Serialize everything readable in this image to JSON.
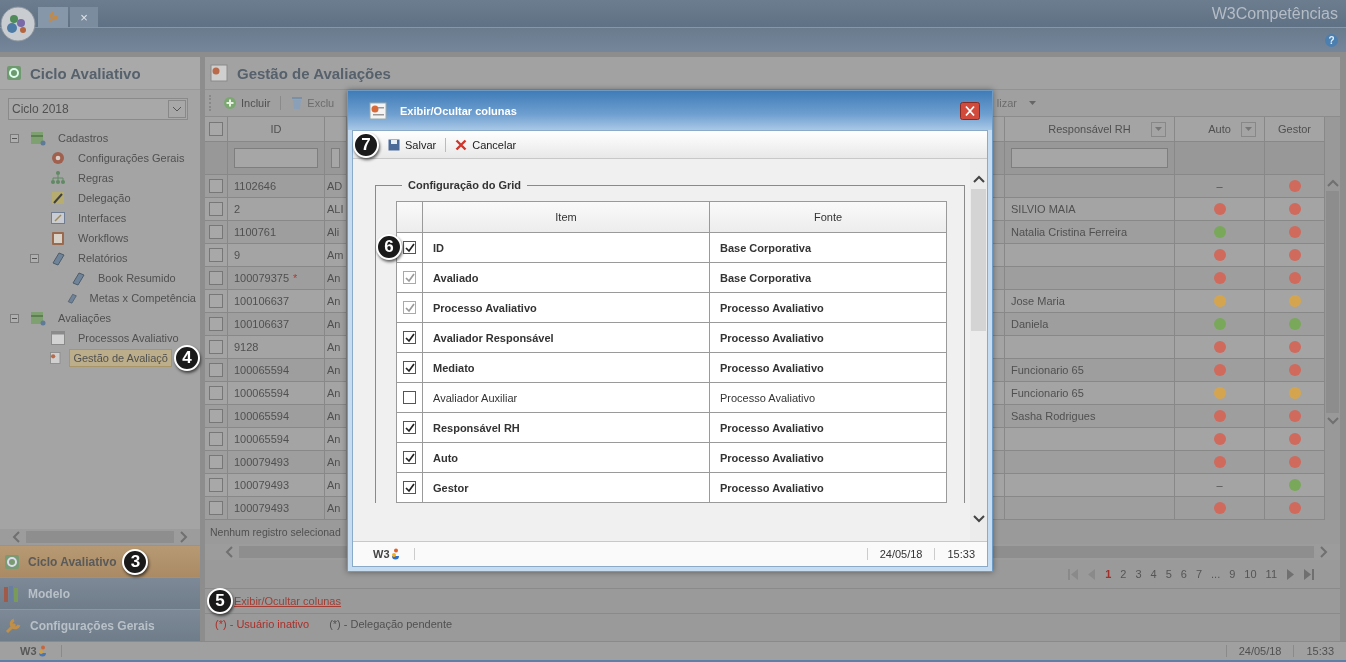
{
  "topbar": {
    "brand": "W3Competências",
    "close_tab": "×",
    "help": "?"
  },
  "sidebar": {
    "title": "Ciclo Avaliativo",
    "cycle_select": {
      "value": "Ciclo 2018"
    },
    "tree": [
      {
        "label": "Cadastros",
        "kind": "folder",
        "expanded": true,
        "selected": false,
        "children": [
          {
            "label": "Configurações Gerais",
            "kind": "gear",
            "selected": false
          },
          {
            "label": "Regras",
            "kind": "org",
            "selected": false
          },
          {
            "label": "Delegação",
            "kind": "pencil",
            "selected": false
          },
          {
            "label": "Interfaces",
            "kind": "form",
            "selected": false
          },
          {
            "label": "Workflows",
            "kind": "clipboard",
            "selected": false
          },
          {
            "label": "Relatórios",
            "kind": "book",
            "expanded": true,
            "selected": false,
            "children": [
              {
                "label": "Book Resumido",
                "kind": "book",
                "selected": false
              },
              {
                "label": "Metas x Competência",
                "kind": "book",
                "selected": false
              }
            ]
          }
        ]
      },
      {
        "label": "Avaliações",
        "kind": "folder",
        "expanded": true,
        "selected": false,
        "children": [
          {
            "label": "Processos Avaliativo",
            "kind": "calendar",
            "selected": false
          },
          {
            "label": "Gestão de Avaliaçõ",
            "kind": "report",
            "selected": true,
            "callout": "4"
          }
        ]
      }
    ],
    "accordion": [
      {
        "label": "Ciclo Avaliativo",
        "kind": "cycle",
        "selected": true,
        "callout": "3"
      },
      {
        "label": "Modelo",
        "kind": "model",
        "selected": false
      },
      {
        "label": "Configurações Gerais",
        "kind": "wrench",
        "selected": false
      }
    ]
  },
  "main": {
    "title": "Gestão de Avaliações",
    "toolbar": [
      {
        "label": "Incluir",
        "kind": "add",
        "disabled": false
      },
      {
        "label": "Exclu",
        "kind": "delete",
        "disabled": true
      }
    ],
    "toolbar_right": "lizar",
    "grid": {
      "header_checked": false,
      "columns": {
        "id": "ID",
        "rh": "Responsável RH",
        "auto": "Auto",
        "gestor": "Gestor"
      },
      "rows": [
        {
          "checked": false,
          "id": "1102646",
          "col3": "AD",
          "auto": {
            "kind": "dash",
            "text": "–"
          },
          "gestor": {
            "kind": "dot",
            "color": "#cf6a5d"
          }
        },
        {
          "checked": false,
          "id": "2",
          "col3": "ALI",
          "rh": "SILVIO MAIA",
          "auto": {
            "kind": "dot",
            "color": "#cf6a5d"
          },
          "gestor": {
            "kind": "dot",
            "color": "#cf6a5d"
          }
        },
        {
          "checked": false,
          "id": "1100761",
          "col3": "Ali",
          "rh": "Natalia Cristina Ferreira",
          "auto": {
            "kind": "dot",
            "color": "#7aa85a"
          },
          "gestor": {
            "kind": "dot",
            "color": "#cf6a5d"
          }
        },
        {
          "checked": false,
          "id": "9",
          "col3": "Am",
          "auto": {
            "kind": "dot",
            "color": "#cf6a5d"
          },
          "gestor": {
            "kind": "dot",
            "color": "#cf6a5d"
          }
        },
        {
          "checked": false,
          "id": "100079375",
          "flag": "*",
          "col3": "An",
          "auto": {
            "kind": "dot",
            "color": "#cf6a5d"
          },
          "gestor": {
            "kind": "dot",
            "color": "#cf6a5d"
          }
        },
        {
          "checked": false,
          "id": "100106637",
          "col3": "An",
          "rh": "Jose Maria",
          "auto": {
            "kind": "dot",
            "color": "#d4a54e"
          },
          "gestor": {
            "kind": "dot",
            "color": "#d4a54e"
          }
        },
        {
          "checked": false,
          "id": "100106637",
          "col3": "An",
          "rh": "Daniela",
          "auto": {
            "kind": "dot",
            "color": "#7aa85a"
          },
          "gestor": {
            "kind": "dot",
            "color": "#7aa85a"
          }
        },
        {
          "checked": false,
          "id": "9128",
          "col3": "An",
          "auto": {
            "kind": "dot",
            "color": "#cf6a5d"
          },
          "gestor": {
            "kind": "dot",
            "color": "#cf6a5d"
          }
        },
        {
          "checked": false,
          "id": "100065594",
          "col3": "An",
          "rh": "Funcionario 65",
          "auto": {
            "kind": "dot",
            "color": "#cf6a5d"
          },
          "gestor": {
            "kind": "dot",
            "color": "#cf6a5d"
          }
        },
        {
          "checked": false,
          "id": "100065594",
          "col3": "An",
          "rh": "Funcionario 65",
          "auto": {
            "kind": "dot",
            "color": "#d4a54e"
          },
          "gestor": {
            "kind": "dot",
            "color": "#d4a54e"
          }
        },
        {
          "checked": false,
          "id": "100065594",
          "col3": "An",
          "rh": "Sasha Rodrigues",
          "auto": {
            "kind": "dot",
            "color": "#cf6a5d"
          },
          "gestor": {
            "kind": "dot",
            "color": "#cf6a5d"
          }
        },
        {
          "checked": false,
          "id": "100065594",
          "col3": "An",
          "auto": {
            "kind": "dot",
            "color": "#cf6a5d"
          },
          "gestor": {
            "kind": "dot",
            "color": "#cf6a5d"
          }
        },
        {
          "checked": false,
          "id": "100079493",
          "col3": "An",
          "auto": {
            "kind": "dot",
            "color": "#cf6a5d"
          },
          "gestor": {
            "kind": "dot",
            "color": "#cf6a5d"
          }
        },
        {
          "checked": false,
          "id": "100079493",
          "col3": "An",
          "auto": {
            "kind": "dash",
            "text": "–"
          },
          "gestor": {
            "kind": "dot",
            "color": "#7aa85a"
          }
        },
        {
          "checked": false,
          "id": "100079493",
          "col3": "An",
          "auto": {
            "kind": "dot",
            "color": "#cf6a5d"
          },
          "gestor": {
            "kind": "dot",
            "color": "#cf6a5d"
          }
        }
      ]
    },
    "selection_info": "Nenhum registro selecionad",
    "pager": [
      {
        "label": "1",
        "selected": true
      },
      {
        "label": "2",
        "selected": false
      },
      {
        "label": "3",
        "selected": false
      },
      {
        "label": "4",
        "selected": false
      },
      {
        "label": "5",
        "selected": false
      },
      {
        "label": "6",
        "selected": false
      },
      {
        "label": "7",
        "selected": false
      },
      {
        "label": "...",
        "selected": false
      },
      {
        "label": "9",
        "selected": false
      },
      {
        "label": "10",
        "selected": false
      },
      {
        "label": "11",
        "selected": false
      }
    ],
    "columns_link": {
      "label": "Exibir/Ocultar colunas",
      "callout": "5"
    },
    "legend": [
      {
        "kind": "inactive",
        "text": "(*) - Usuário inativo"
      },
      {
        "kind": "pending",
        "text": "(*) - Delegação pendente"
      }
    ]
  },
  "status_bar": {
    "logo": "W3",
    "date": "24/05/18",
    "time": "15:33"
  },
  "dialog": {
    "title": "Exibir/Ocultar colunas",
    "toolbar": [
      {
        "kind": "save",
        "label": "Salvar",
        "callout": "7"
      },
      {
        "kind": "cancel",
        "label": "Cancelar"
      }
    ],
    "fieldset": "Configuração do Grid",
    "columns": [
      "Item",
      "Fonte"
    ],
    "rows": [
      {
        "item": "ID",
        "source": "Base Corporativa",
        "checked": true,
        "disabled": false,
        "callout": "6"
      },
      {
        "item": "Avaliado",
        "source": "Base Corporativa",
        "checked": true,
        "disabled": true
      },
      {
        "item": "Processo Avaliativo",
        "source": "Processo Avaliativo",
        "checked": true,
        "disabled": true
      },
      {
        "item": "Avaliador Responsável",
        "source": "Processo Avaliativo",
        "checked": true,
        "disabled": false
      },
      {
        "item": "Mediato",
        "source": "Processo Avaliativo",
        "checked": true,
        "disabled": false
      },
      {
        "item": "Avaliador Auxiliar",
        "source": "Processo Avaliativo",
        "checked": false,
        "disabled": false
      },
      {
        "item": "Responsável RH",
        "source": "Processo Avaliativo",
        "checked": true,
        "disabled": false
      },
      {
        "item": "Auto",
        "source": "Processo Avaliativo",
        "checked": true,
        "disabled": false
      },
      {
        "item": "Gestor",
        "source": "Processo Avaliativo",
        "checked": true,
        "disabled": false
      }
    ],
    "status": {
      "logo": "W3",
      "date": "24/05/18",
      "time": "15:33"
    }
  }
}
